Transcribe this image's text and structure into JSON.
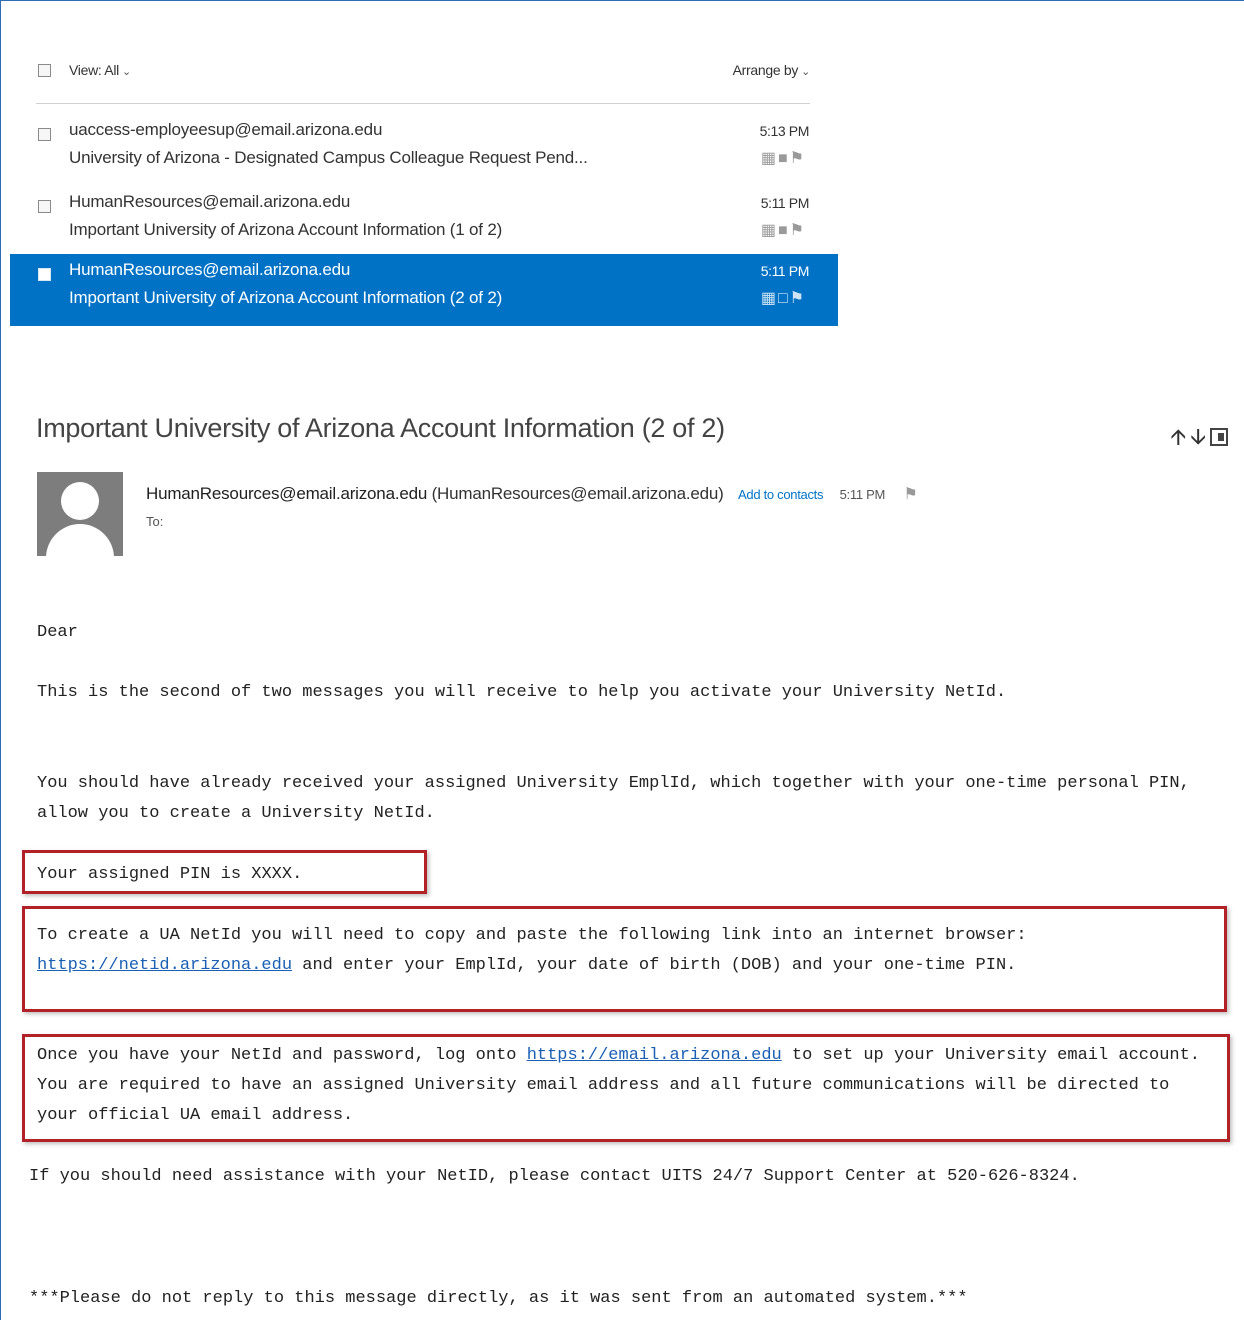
{
  "colors": {
    "accent": "#0072c6",
    "highlight_box": "#b22028",
    "link": "#1a5fb4"
  },
  "message_list": {
    "view_label": "View: All",
    "arrange_label": "Arrange by",
    "messages": [
      {
        "sender": "uaccess-employeesup@email.arizona.edu",
        "subject": "University of Arizona - Designated Campus Colleague Request Pend...",
        "time": "5:13 PM",
        "selected": false
      },
      {
        "sender": "HumanResources@email.arizona.edu",
        "subject": "Important University of Arizona Account Information (1 of 2)",
        "time": "5:11 PM",
        "selected": false
      },
      {
        "sender": "HumanResources@email.arizona.edu",
        "subject": "Important University of Arizona Account Information (2 of 2)",
        "time": "5:11 PM",
        "selected": true
      }
    ],
    "row_action_icons": [
      "sweep-icon",
      "delete-icon",
      "flag-icon"
    ]
  },
  "reading_pane": {
    "subject": "Important University of Arizona Account Information (2 of 2)",
    "nav_icons": [
      "up-arrow-icon",
      "down-arrow-icon",
      "popout-icon"
    ],
    "from_address": "HumanResources@email.arizona.edu",
    "from_display": "(HumanResources@email.arizona.edu)",
    "add_to_contacts": "Add to contacts",
    "time": "5:11 PM",
    "to_label": "To:",
    "body": {
      "greeting": "Dear",
      "p_intro": "This is the second of two messages you will receive to help you activate your University NetId.",
      "p_received": "You should have already received your assigned University EmplId, which together with your one-time personal PIN, allow you to create a University NetId.",
      "p_pin_prefix": "Your assigned PIN is ",
      "pin_value": "XXXX",
      "p_pin_suffix": ".",
      "p_create_before": "To create a UA NetId you will need to copy and paste the following link into an internet browser: ",
      "netid_link": "https://netid.arizona.edu",
      "p_create_after": " and enter your EmplId, your date of birth (DOB) and your one-time PIN.",
      "p_once_before": "Once you have your NetId and password, log onto ",
      "email_link": "https://email.arizona.edu",
      "p_once_after": " to set up your University email account. You are required to have an assigned University email address and all future communications will be directed to your official UA email address.",
      "p_assist": "If you should need assistance with your NetID, please contact UITS 24/7 Support Center at 520-626-8324.",
      "p_noreply": "***Please do not reply to this message directly, as it was sent from an automated system.***"
    }
  }
}
